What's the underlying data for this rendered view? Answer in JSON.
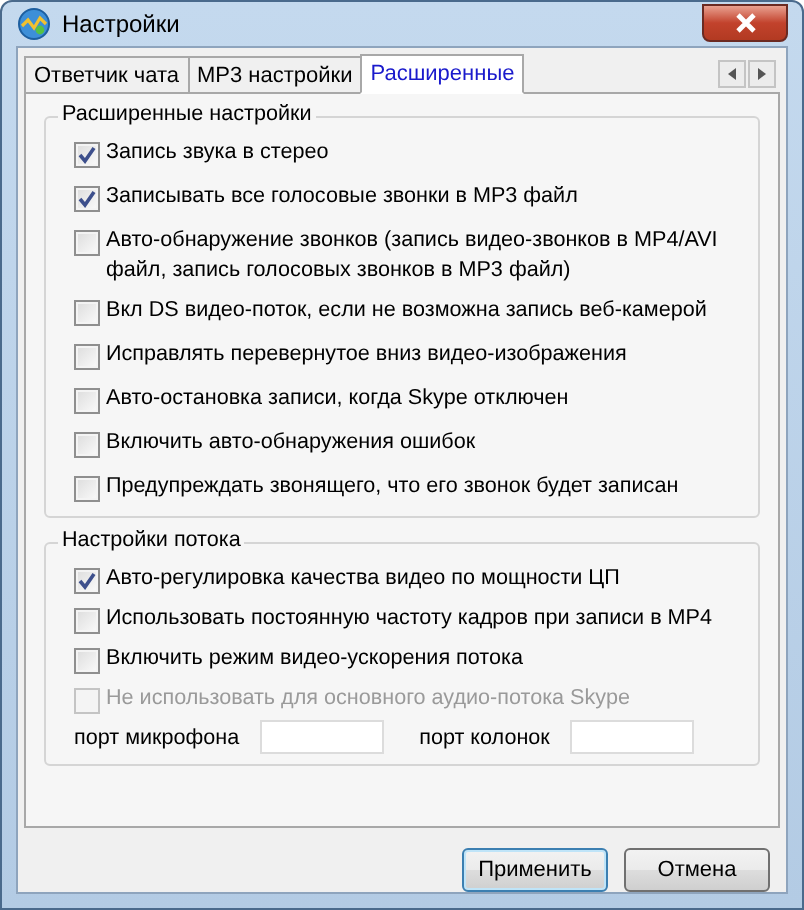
{
  "window": {
    "title": "Настройки"
  },
  "tabs": [
    {
      "label": "Ответчик чата",
      "selected": false
    },
    {
      "label": "MP3 настройки",
      "selected": false
    },
    {
      "label": "Расширенные",
      "selected": true
    }
  ],
  "groups": [
    {
      "title": "Расширенные настройки",
      "options": [
        {
          "label": "Запись звука в стерео",
          "checked": true,
          "disabled": false
        },
        {
          "label": "Записывать все голосовые звонки в MP3 файл",
          "checked": true,
          "disabled": false
        },
        {
          "label": "Авто-обнаружение звонков (запись видео-звонков в MP4/AVI файл, запись голосовых звонков в MP3 файл)",
          "checked": false,
          "disabled": false
        },
        {
          "label": "Вкл DS видео-поток, если не возможна запись веб-камерой",
          "checked": false,
          "disabled": false
        },
        {
          "label": "Исправлять перевернутое вниз видео-изображения",
          "checked": false,
          "disabled": false
        },
        {
          "label": "Авто-остановка записи, когда Skype отключен",
          "checked": false,
          "disabled": false
        },
        {
          "label": "Включить авто-обнаружения ошибок",
          "checked": false,
          "disabled": false
        },
        {
          "label": "Предупреждать звонящего, что его звонок будет записан",
          "checked": false,
          "disabled": false
        }
      ]
    },
    {
      "title": "Настройки потока",
      "options": [
        {
          "label": "Авто-регулировка качества видео по мощности ЦП",
          "checked": true,
          "disabled": false
        },
        {
          "label": "Использовать постоянную частоту кадров при записи в MP4",
          "checked": false,
          "disabled": false
        },
        {
          "label": "Включить режим видео-ускорения потока",
          "checked": false,
          "disabled": false
        },
        {
          "label": "Не использовать для основного аудио-потока Skype",
          "checked": false,
          "disabled": true
        }
      ],
      "fields": [
        {
          "label": "порт микрофона"
        },
        {
          "label": "порт колонок"
        }
      ]
    }
  ],
  "buttons": [
    {
      "label": "Применить",
      "default": true
    },
    {
      "label": "Отмена",
      "default": false
    }
  ]
}
